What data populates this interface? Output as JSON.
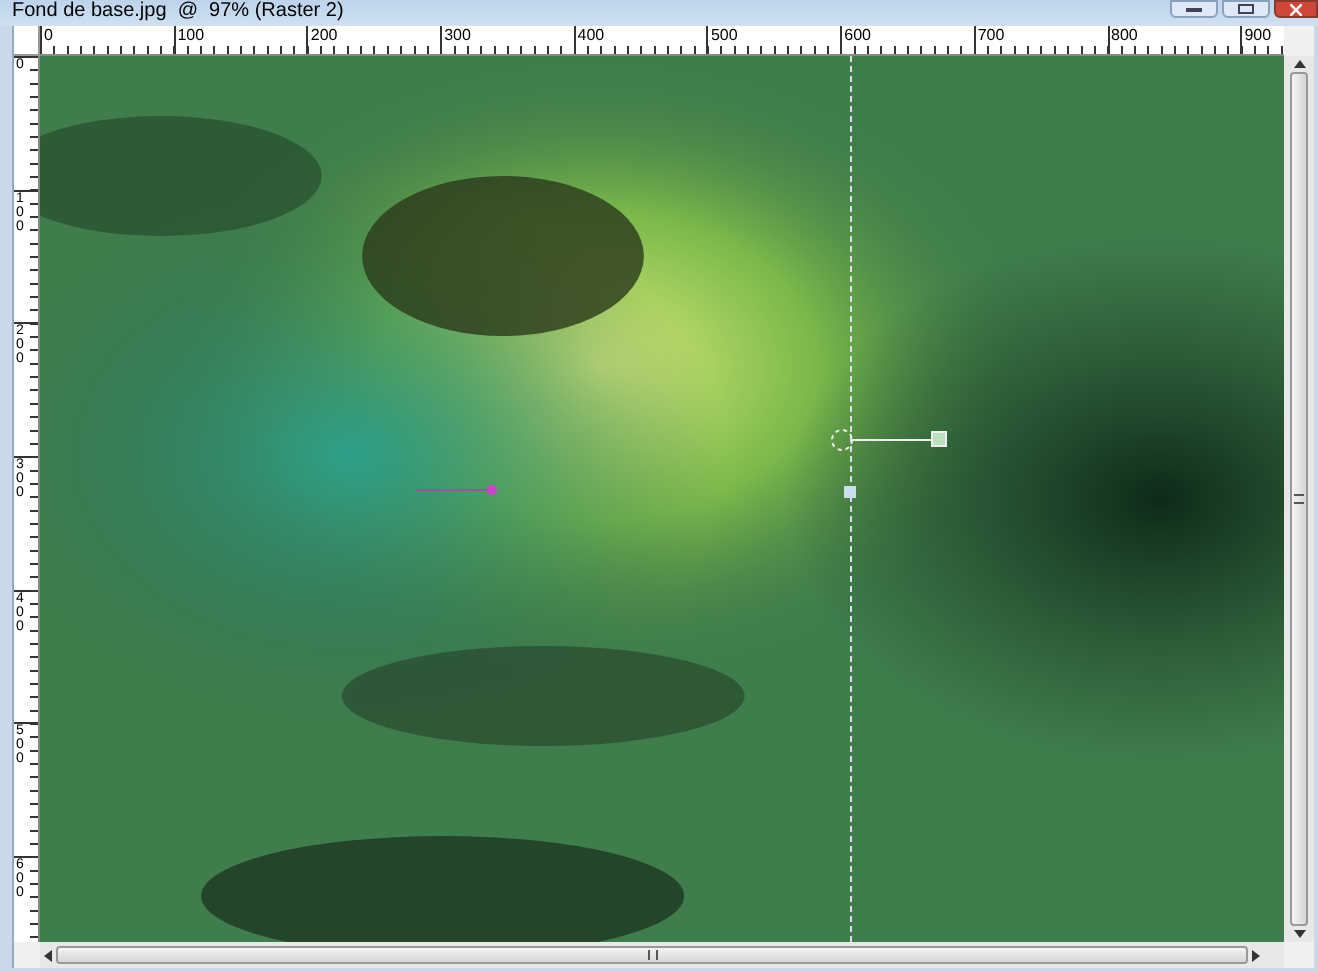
{
  "window": {
    "title": "Fond de base.jpg  @  97% (Raster 2)"
  },
  "horizontal_ruler": {
    "labels": [
      "0",
      "100",
      "200",
      "300",
      "400",
      "500",
      "600",
      "700",
      "800",
      "900"
    ]
  },
  "vertical_ruler": {
    "labels": [
      "0",
      "100",
      "200",
      "300",
      "400",
      "500",
      "600"
    ]
  }
}
